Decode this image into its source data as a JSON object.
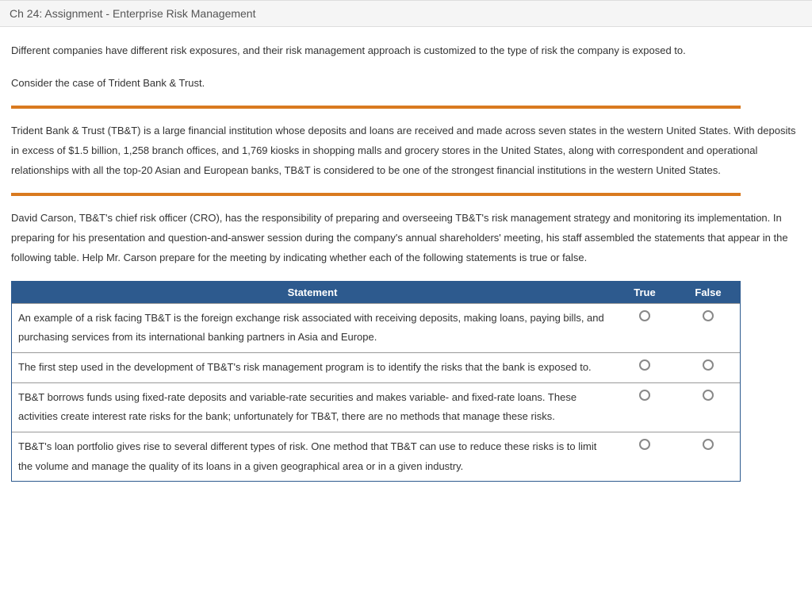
{
  "header": {
    "title": "Ch 24: Assignment - Enterprise Risk Management"
  },
  "paragraphs": {
    "intro": "Different companies have different risk exposures, and their risk management approach is customized to the type of risk the company is exposed to.",
    "consider": "Consider the case of Trident Bank & Trust.",
    "description": "Trident Bank & Trust (TB&T) is a large financial institution whose deposits and loans are received and made across seven states in the western United States. With deposits in excess of $1.5 billion, 1,258 branch offices, and 1,769 kiosks in shopping malls and grocery stores in the United States, along with correspondent and operational relationships with all the top-20 Asian and European banks, TB&T is considered to be one of the strongest financial institutions in the western United States.",
    "instruction": "David Carson, TB&T's chief risk officer (CRO), has the responsibility of preparing and overseeing TB&T's risk management strategy and monitoring its implementation. In preparing for his presentation and question-and-answer session during the company's annual shareholders' meeting, his staff assembled the statements that appear in the following table. Help Mr. Carson prepare for the meeting by indicating whether each of the following statements is true or false."
  },
  "table": {
    "headers": {
      "statement": "Statement",
      "true": "True",
      "false": "False"
    },
    "rows": [
      {
        "statement": "An example of a risk facing TB&T is the foreign exchange risk associated with receiving deposits, making loans, paying bills, and purchasing services from its international banking partners in Asia and Europe."
      },
      {
        "statement": "The first step used in the development of TB&T's risk management program is to identify the risks that the bank is exposed to."
      },
      {
        "statement": "TB&T borrows funds using fixed-rate deposits and variable-rate securities and makes variable- and fixed-rate loans. These activities create interest rate risks for the bank; unfortunately for TB&T, there are no methods that manage these risks."
      },
      {
        "statement": "TB&T's loan portfolio gives rise to several different types of risk. One method that TB&T can use to reduce these risks is to limit the volume and manage the quality of its loans in a given geographical area or in a given industry."
      }
    ]
  }
}
